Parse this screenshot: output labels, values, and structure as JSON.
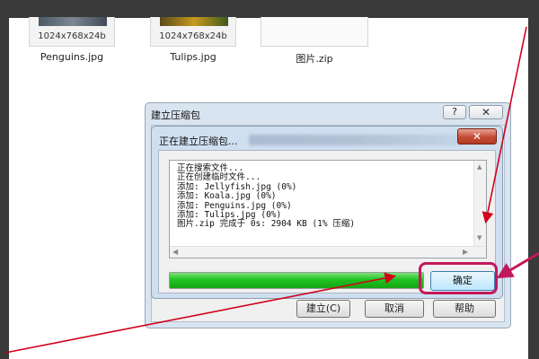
{
  "explorer": {
    "files": [
      {
        "name": "Penguins.jpg",
        "dims": "1024x768x24b"
      },
      {
        "name": "Tulips.jpg",
        "dims": "1024x768x24b"
      },
      {
        "name": "图片.zip",
        "dims": ""
      }
    ]
  },
  "outer_dialog": {
    "title": "建立压缩包",
    "help_label": "?",
    "close_label": "✕",
    "buttons": [
      "建立(C)",
      "取消",
      "帮助"
    ]
  },
  "inner_dialog": {
    "title": "正在建立压缩包...",
    "close_label": "✕",
    "log_lines": [
      "正在搜索文件...",
      "正在创建临时文件...",
      "添加: Jellyfish.jpg (0%)",
      "添加: Koala.jpg (0%)",
      "添加: Penguins.jpg (0%)",
      "添加: Tulips.jpg (0%)",
      "图片.zip 完成于 0s: 2904 KB (1% 压缩)"
    ],
    "progress_fraction": 1.0,
    "ok_label": "确定"
  },
  "colors": {
    "annotation_arrow": "#d0021b",
    "annotation_highlight": "#c2185b",
    "progress_green": "#1fc31f"
  }
}
